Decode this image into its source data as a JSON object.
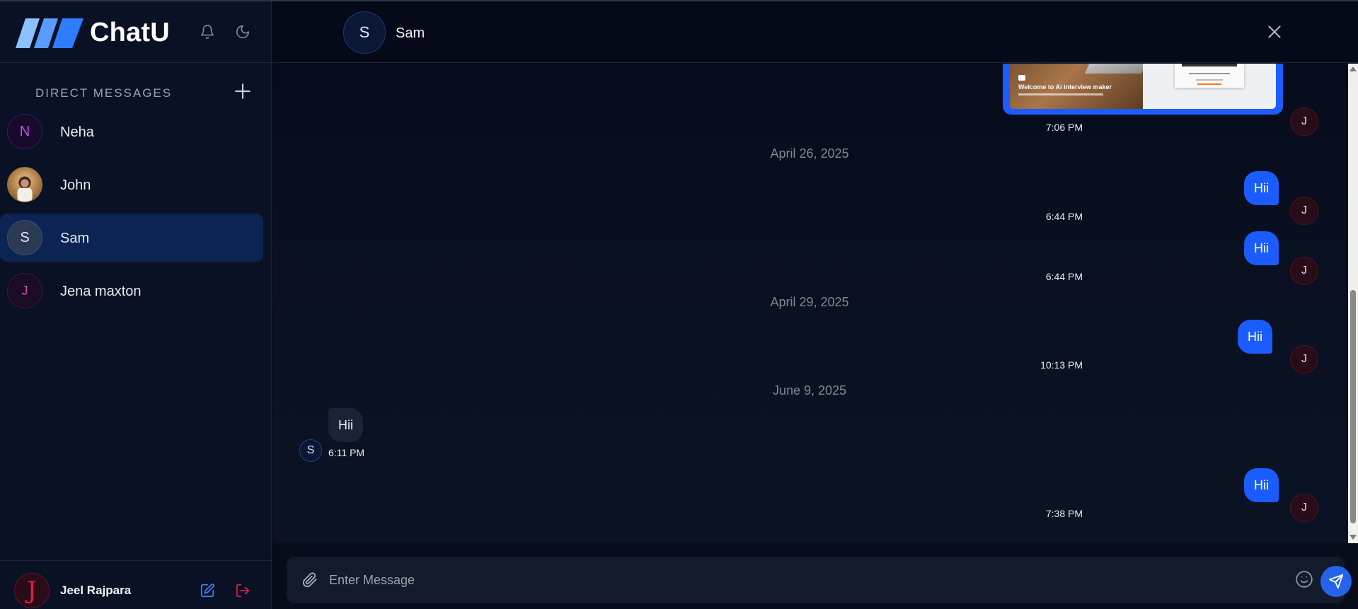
{
  "app": {
    "name": "ChatU"
  },
  "sidebar": {
    "section_title": "DIRECT MESSAGES",
    "contacts": [
      {
        "name": "Neha",
        "initial": "N",
        "active": false
      },
      {
        "name": "John",
        "initial": "",
        "active": false
      },
      {
        "name": "Sam",
        "initial": "S",
        "active": true
      },
      {
        "name": "Jena maxton",
        "initial": "J",
        "active": false
      }
    ],
    "current_user": {
      "name": "Jeel Rajpara",
      "initial": "J"
    }
  },
  "chat": {
    "contact": {
      "name": "Sam",
      "initial": "S"
    },
    "image_message": {
      "caption": "Welcome to Ai interview maker",
      "time": "7:06 PM"
    },
    "date_1": "April 26, 2025",
    "msg_1": {
      "text": "Hii",
      "time": "6:44 PM",
      "sender_initial": "J"
    },
    "msg_2": {
      "text": "Hii",
      "time": "6:44 PM",
      "sender_initial": "J"
    },
    "date_2": "April 29, 2025",
    "msg_3": {
      "text": "Hii",
      "time": "10:13 PM",
      "sender_initial": "J"
    },
    "date_3": "June 9, 2025",
    "msg_4": {
      "text": "Hii",
      "time": "6:11 PM",
      "sender_initial": "S"
    },
    "msg_5": {
      "text": "Hii",
      "time": "7:38 PM",
      "sender_initial": "J"
    }
  },
  "composer": {
    "placeholder": "Enter Message"
  },
  "colors": {
    "accent": "#1a5cff",
    "background": "#070b1a",
    "active_contact": "#0c2454",
    "logout": "#e11d48"
  }
}
